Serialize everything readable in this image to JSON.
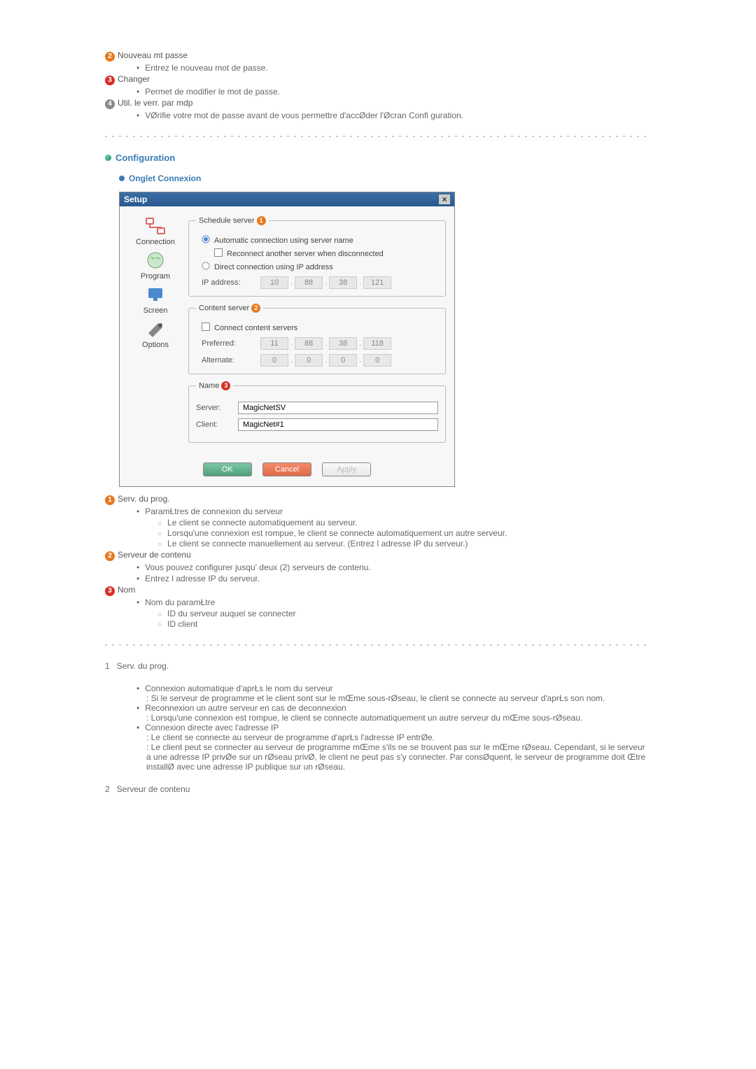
{
  "top_list": [
    {
      "num": "2",
      "class": "badge-orange",
      "label": "Nouveau mt passe",
      "bullets": [
        "Entrez le nouveau mot de passe."
      ]
    },
    {
      "num": "3",
      "class": "badge-red",
      "label": "Changer",
      "bullets": [
        "Permet de modifier le mot de passe."
      ]
    },
    {
      "num": "4",
      "class": "badge-gray",
      "label": "Util. le verr. par mdp",
      "bullets": [
        "VØrifie votre mot de passe avant de vous permettre d'accØder   l'Øcran Confi               guration."
      ]
    }
  ],
  "section_title": "Configuration",
  "subsection_title": "Onglet Connexion",
  "dialog": {
    "title": "Setup",
    "close": "×",
    "sidebar": [
      {
        "label": "Connection"
      },
      {
        "label": "Program"
      },
      {
        "label": "Screen"
      },
      {
        "label": "Options"
      }
    ],
    "schedule": {
      "legend": "Schedule server",
      "opt1": "Automatic connection using server name",
      "opt1_checked": true,
      "opt1_sub": "Reconnect another server when disconnected",
      "opt2": "Direct connection using IP address",
      "ip_label": "IP address:",
      "ip": [
        "10",
        "88",
        "38",
        "121"
      ]
    },
    "content": {
      "legend": "Content server",
      "checkbox": "Connect content servers",
      "preferred_label": "Preferred:",
      "preferred": [
        "11",
        "88",
        "38",
        "118"
      ],
      "alternate_label": "Alternate:",
      "alternate": [
        "0",
        "0",
        "0",
        "0"
      ]
    },
    "name": {
      "legend": "Name",
      "server_label": "Server:",
      "server_value": "MagicNetSV",
      "client_label": "Client:",
      "client_value": "MagicNet#1"
    },
    "buttons": {
      "ok": "OK",
      "cancel": "Cancel",
      "apply": "Apply"
    }
  },
  "below_list": [
    {
      "num": "1",
      "class": "badge-orange",
      "label": "Serv. du prog.",
      "bullets": [
        {
          "text": "ParamŁtres de connexion du serveur",
          "subs": [
            "Le client se connecte automatiquement au serveur.",
            "Lorsqu'une connexion est rompue, le client se connecte automatiquement   un autre serveur.",
            "Le client se connecte manuellement au serveur. (Entrez l adresse IP du serveur.)"
          ]
        }
      ]
    },
    {
      "num": "2",
      "class": "badge-orange",
      "label": "Serveur de contenu",
      "bullets": [
        {
          "text": "Vous pouvez configurer jusqu'  deux (2) serveurs de contenu."
        },
        {
          "text": "Entrez l adresse IP du serveur."
        }
      ]
    },
    {
      "num": "3",
      "class": "badge-red",
      "label": "Nom",
      "bullets": [
        {
          "text": "Nom du paramŁtre",
          "subs": [
            "ID du serveur auquel se connecter",
            "ID client"
          ]
        }
      ]
    }
  ],
  "num_section": [
    {
      "num": "1",
      "title": "Serv. du prog.",
      "items": [
        {
          "head": "Connexion automatique d'aprŁs le nom du serveur",
          "lines": [
            ": Si le serveur de programme et le client sont sur le mŒme sous-rØseau, le client se connecte au serveur d'aprŁs son nom."
          ]
        },
        {
          "head": "Reconnexion   un autre serveur en cas de deconnexion",
          "lines": [
            ": Lorsqu'une connexion est rompue, le client se connecte automatiquement   un autre serveur du mŒme sous-rØseau."
          ]
        },
        {
          "head": "Connexion directe avec l'adresse IP",
          "lines": [
            ": Le client se connecte au serveur de programme d'aprŁs l'adresse IP entrØe.",
            ": Le client peut se connecter au serveur de programme mŒme s'ils ne se trouvent pas sur le mŒme rØseau. Cependant, si le serveur a une adresse IP privØe sur un rØseau privØ, le client ne peut pas s'y connecter. Par consØquent, le serveur de programme doit Œtre installØ avec une adresse IP publique sur un rØseau."
          ]
        }
      ]
    },
    {
      "num": "2",
      "title": "Serveur de contenu",
      "items": []
    }
  ]
}
